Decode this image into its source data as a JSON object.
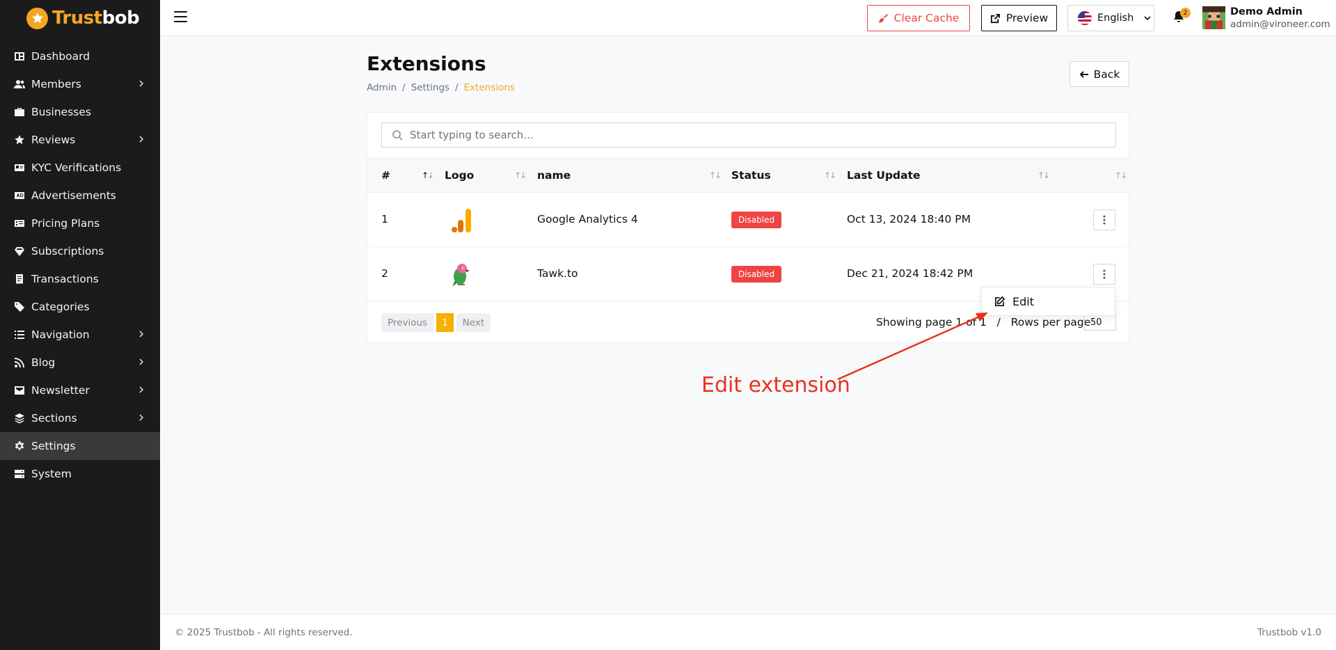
{
  "brand": {
    "part1": "Trust",
    "part2": "bob"
  },
  "sidebar": {
    "items": [
      {
        "label": "Dashboard",
        "icon": "dashboard-icon"
      },
      {
        "label": "Members",
        "icon": "users-icon",
        "has_children": true
      },
      {
        "label": "Businesses",
        "icon": "briefcase-icon"
      },
      {
        "label": "Reviews",
        "icon": "star-icon",
        "has_children": true
      },
      {
        "label": "KYC Verifications",
        "icon": "id-card-icon"
      },
      {
        "label": "Advertisements",
        "icon": "ad-icon"
      },
      {
        "label": "Pricing Plans",
        "icon": "price-tag-icon"
      },
      {
        "label": "Subscriptions",
        "icon": "gem-icon"
      },
      {
        "label": "Transactions",
        "icon": "receipt-icon"
      },
      {
        "label": "Categories",
        "icon": "tags-icon"
      },
      {
        "label": "Navigation",
        "icon": "list-icon",
        "has_children": true
      },
      {
        "label": "Blog",
        "icon": "rss-icon",
        "has_children": true
      },
      {
        "label": "Newsletter",
        "icon": "mail-icon",
        "has_children": true
      },
      {
        "label": "Sections",
        "icon": "layers-icon",
        "has_children": true
      },
      {
        "label": "Settings",
        "icon": "gear-icon",
        "active": true
      },
      {
        "label": "System",
        "icon": "server-icon"
      }
    ]
  },
  "topbar": {
    "clear_cache": "Clear Cache",
    "preview": "Preview",
    "language": "English",
    "notifications_count": "2",
    "user_name": "Demo Admin",
    "user_email": "admin@vironeer.com"
  },
  "page": {
    "title": "Extensions",
    "breadcrumb": [
      "Admin",
      "Settings",
      "Extensions"
    ],
    "back": "Back"
  },
  "search": {
    "placeholder": "Start typing to search..."
  },
  "table": {
    "headers": [
      "#",
      "Logo",
      "name",
      "Status",
      "Last Update"
    ],
    "rows": [
      {
        "num": "1",
        "logo": "google-analytics-logo",
        "name": "Google Analytics 4",
        "status": "Disabled",
        "updated": "Oct 13, 2024 18:40 PM"
      },
      {
        "num": "2",
        "logo": "tawk-to-logo",
        "name": "Tawk.to",
        "status": "Disabled",
        "updated": "Dec 21, 2024 18:42 PM"
      }
    ]
  },
  "pagination": {
    "previous": "Previous",
    "current": "1",
    "next": "Next",
    "showing": "Showing page 1 of 1",
    "rows_per_page_label": "Rows per page",
    "rows_per_page_value": "50"
  },
  "dropdown": {
    "edit": "Edit"
  },
  "annotation": {
    "text": "Edit extension"
  },
  "footer": {
    "copyright": "© 2025 Trustbob - All rights reserved.",
    "version": "Trustbob v1.0"
  },
  "colors": {
    "accent": "#f5a623",
    "danger": "#ef4444",
    "sidebar_bg": "#1b1b1b",
    "annotation": "#e8321c"
  }
}
